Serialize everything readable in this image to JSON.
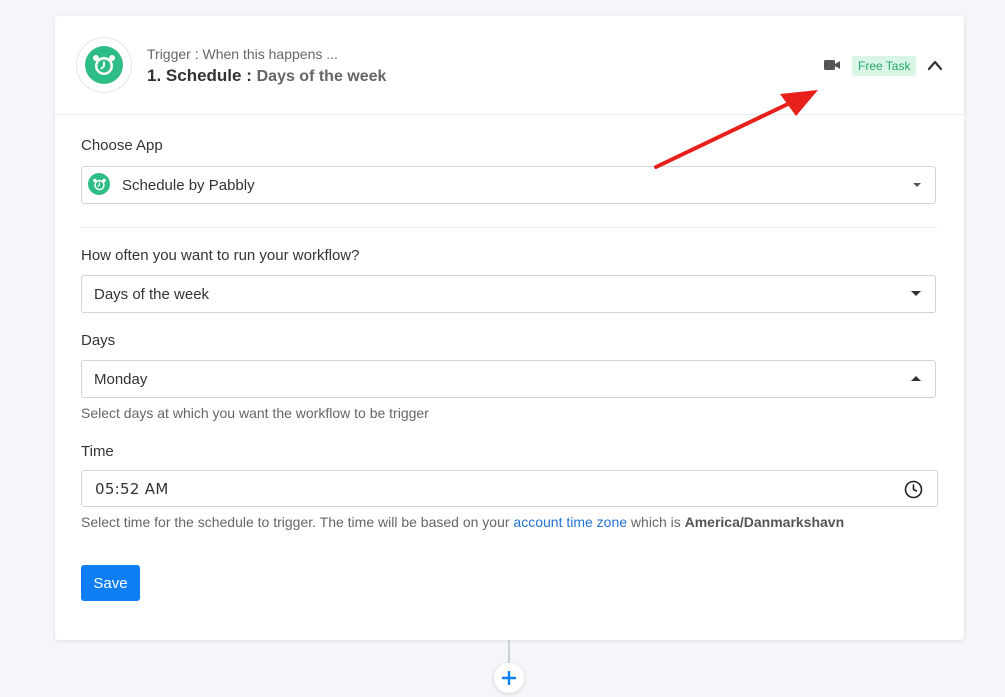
{
  "header": {
    "subtitle": "Trigger : When this happens ...",
    "step_label": "1. Schedule :",
    "event_label": "Days of the week",
    "badge_label": "Free Task"
  },
  "choose_app": {
    "label": "Choose App",
    "value": "Schedule by Pabbly"
  },
  "frequency": {
    "label": "How often you want to run your workflow?",
    "value": "Days of the week"
  },
  "days": {
    "label": "Days",
    "value": "Monday",
    "help": "Select days at which you want the workflow to be trigger"
  },
  "time": {
    "label": "Time",
    "value": "05:52 AM",
    "help_prefix": "Select time for the schedule to trigger. The time will be based on your ",
    "help_link": "account time zone",
    "help_middle": " which is ",
    "help_timezone": "America/Danmarkshavn"
  },
  "save_label": "Save",
  "colors": {
    "app_green": "#2ebd85",
    "primary_blue": "#0d7ef3",
    "link_blue": "#2374d4",
    "badge_bg": "#d8f5e6",
    "badge_text": "#26a86a",
    "annotation_red": "#e8201c"
  },
  "icons": {
    "app": "alarm-clock-icon",
    "video": "video-camera-icon",
    "collapse": "chevron-up-icon",
    "clock": "clock-icon",
    "add": "plus-icon"
  }
}
